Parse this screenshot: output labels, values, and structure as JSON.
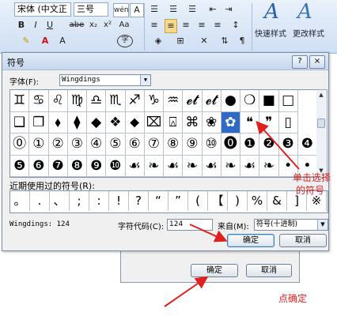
{
  "ribbon": {
    "font_name": "宋体 (中文正",
    "font_size": "三号",
    "wen_btn": "wén",
    "A_btn": "A",
    "bold": "B",
    "italic": "I",
    "underline": "U",
    "strike": "abe",
    "sub": "x₂",
    "sup": "x²",
    "aa_btn": "Aa",
    "quick_styles": "快速样式",
    "change_styles": "更改样式"
  },
  "dialog": {
    "title": "符号",
    "help": "?",
    "close": "×",
    "font_label": "字体(F):",
    "font_value": "Wingdings",
    "symbols_row1": [
      "♊",
      "♋",
      "♌",
      "♍",
      "♎",
      "♏",
      "♐",
      "♑",
      "♒",
      "𝓮𝓽",
      "𝓮𝓽",
      "●",
      "❍",
      "■",
      "□"
    ],
    "symbols_row2": [
      "❑",
      "❒",
      "⬧",
      "⧫",
      "◆",
      "❖",
      "⬥",
      "⌧",
      "⍓",
      "⌘",
      "❀",
      "✿",
      "❝",
      "❞",
      "▯"
    ],
    "symbols_row3": [
      "⓪",
      "①",
      "②",
      "③",
      "④",
      "⑤",
      "⑥",
      "⑦",
      "⑧",
      "⑨",
      "⑩",
      "⓿",
      "❶",
      "❷",
      "❸",
      "❹"
    ],
    "symbols_row4": [
      "❺",
      "❻",
      "❼",
      "❽",
      "❾",
      "❿",
      "☙",
      "❧",
      "☙",
      "❧",
      "☙",
      "❧",
      "☙",
      "❧",
      "•",
      "•"
    ],
    "recent_label": "近期使用过的符号(R):",
    "recent": [
      "。",
      ".",
      "、",
      ";",
      ":",
      "!",
      "?",
      "“",
      "”",
      "(",
      "【",
      ")",
      "%",
      "&",
      "]",
      "※"
    ],
    "status_text": "Wingdings: 124",
    "code_label": "字符代码(C):",
    "code_value": "124",
    "from_label": "来自(M):",
    "from_value": "符号(十进制)",
    "ok": "确定",
    "cancel": "取消"
  },
  "outer_dialog": {
    "ok": "确定",
    "cancel": "取消"
  },
  "annotations": {
    "click_select": "单击选择",
    "the_symbol": "的符号",
    "click_ok": "点确定"
  },
  "colors": {
    "selection": "#316ac5",
    "annotation": "#e02020"
  }
}
